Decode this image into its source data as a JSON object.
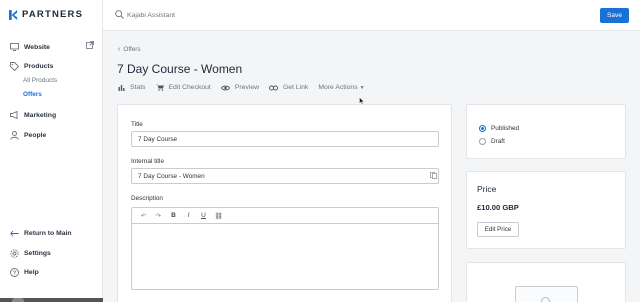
{
  "brand": {
    "name": "PARTNERS",
    "accent": "#1b70d6"
  },
  "sidebar": {
    "items": [
      {
        "label": "Website",
        "icon": "monitor-icon"
      },
      {
        "label": "Products",
        "icon": "tag-icon"
      },
      {
        "label": "Marketing",
        "icon": "megaphone-icon"
      },
      {
        "label": "People",
        "icon": "person-icon"
      }
    ],
    "products_sub": [
      {
        "label": "All Products"
      },
      {
        "label": "Offers",
        "active": true
      }
    ],
    "bottom": [
      {
        "label": "Return to Main",
        "icon": "return-arrow-icon"
      },
      {
        "label": "Settings",
        "icon": "gear-icon"
      },
      {
        "label": "Help",
        "icon": "help-icon"
      }
    ]
  },
  "topbar": {
    "search_placeholder": "Kajabi Assistant",
    "save_label": "Save"
  },
  "breadcrumb": {
    "label": "Offers"
  },
  "page": {
    "title": "7 Day Course - Women"
  },
  "actions": {
    "stats": "Stats",
    "edit_checkout": "Edit Checkout",
    "preview": "Preview",
    "get_link": "Get Link",
    "more_actions": "More Actions"
  },
  "form": {
    "title_label": "Title",
    "title_value": "7 Day Course",
    "internal_title_label": "Internal title",
    "internal_title_value": "7 Day Course - Women",
    "description_label": "Description"
  },
  "editor_toolbar": {
    "undo": "↶",
    "redo": "↷",
    "bold": "B",
    "italic": "I",
    "underline": "U",
    "link": "⛓"
  },
  "status": {
    "published_label": "Published",
    "draft_label": "Draft",
    "selected": "Published"
  },
  "price": {
    "heading": "Price",
    "value": "£10.00 GBP",
    "edit_label": "Edit Price"
  }
}
